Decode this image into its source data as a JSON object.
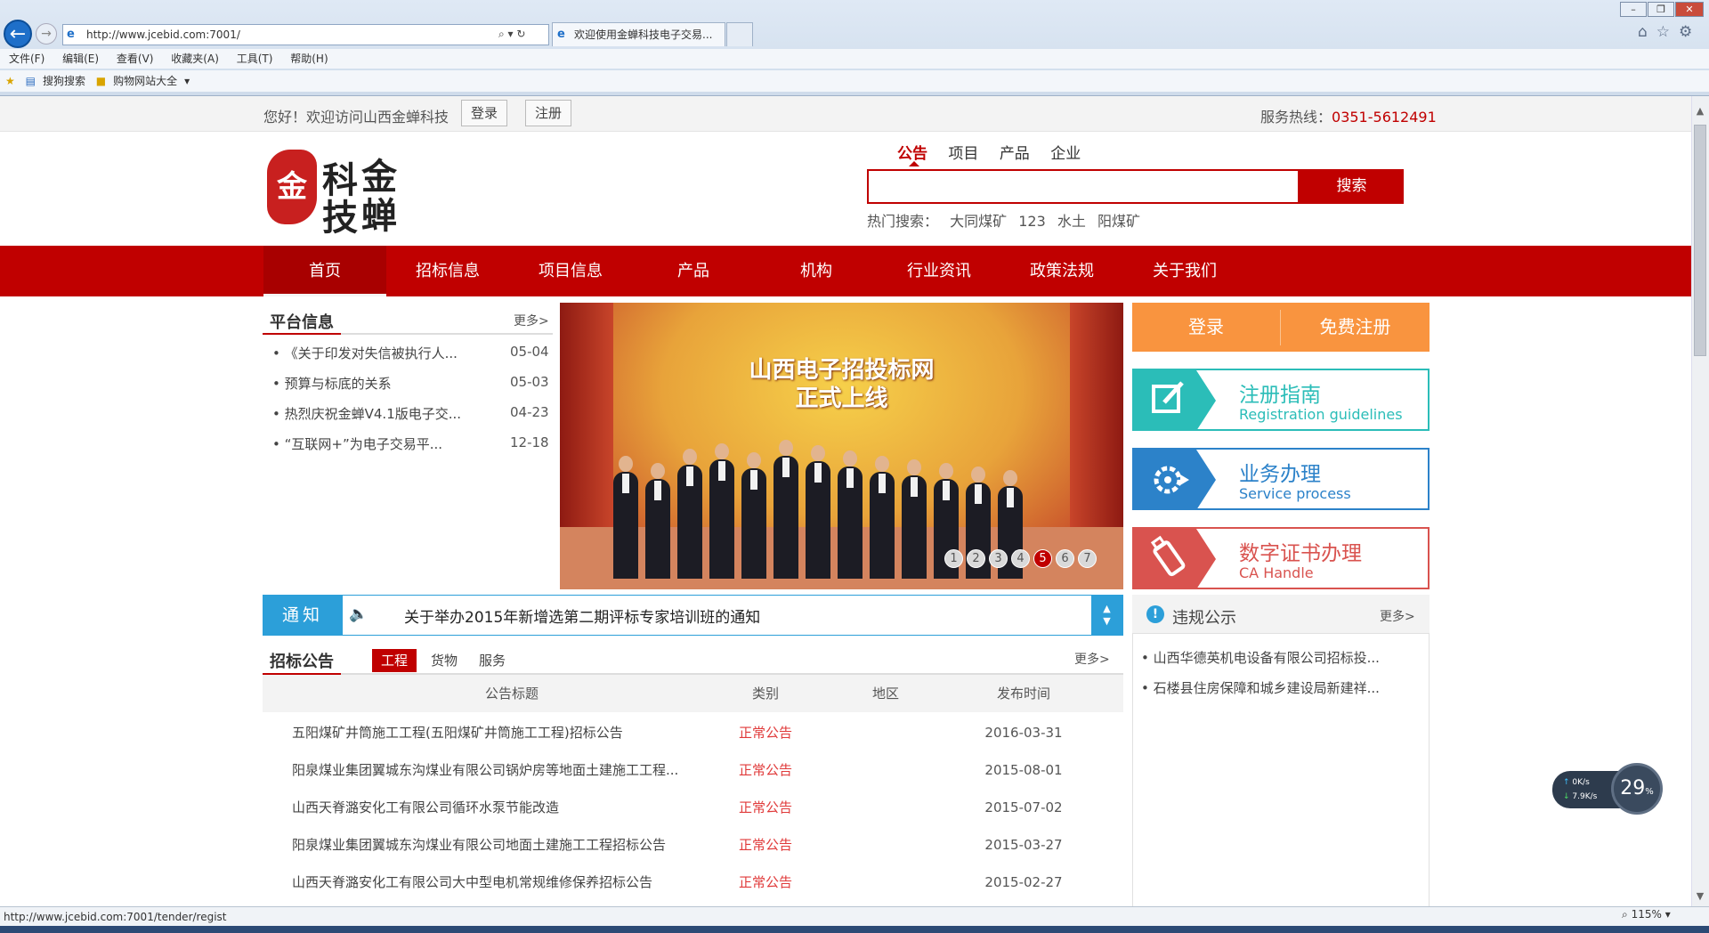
{
  "browser": {
    "url": "http://www.jcebid.com:7001/",
    "tab_title": "欢迎使用金蝉科技电子交易...",
    "menu": [
      "文件(F)",
      "编辑(E)",
      "查看(V)",
      "收藏夹(A)",
      "工具(T)",
      "帮助(H)"
    ],
    "favorites": [
      "搜狗搜索",
      "购物网站大全"
    ],
    "status_url": "http://www.jcebid.com:7001/tender/regist",
    "zoom": "115%"
  },
  "topbar": {
    "welcome": "您好！欢迎访问山西金蝉科技",
    "login": "登录",
    "register": "注册",
    "hotline_label": "服务热线：",
    "hotline_number": "0351-5612491"
  },
  "logo": {
    "seal": "金",
    "chars": [
      "科",
      "金",
      "技",
      "蝉"
    ]
  },
  "search": {
    "tabs": [
      "公告",
      "项目",
      "产品",
      "企业"
    ],
    "active_tab": "公告",
    "value": "",
    "button": "搜索",
    "hot_label": "热门搜索：",
    "hot_terms": [
      "大同煤矿",
      "123",
      "水土",
      "阳煤矿"
    ]
  },
  "nav": [
    "首页",
    "招标信息",
    "项目信息",
    "产品",
    "机构",
    "行业资讯",
    "政策法规",
    "关于我们"
  ],
  "platform": {
    "title": "平台信息",
    "more": "更多>",
    "items": [
      {
        "text": "• 《关于印发对失信被执行人...",
        "date": "05-04"
      },
      {
        "text": "• 预算与标底的关系",
        "date": "05-03"
      },
      {
        "text": "• 热烈庆祝金蝉V4.1版电子交...",
        "date": "04-23"
      },
      {
        "text": "• “互联网+”为电子交易平...",
        "date": "12-18"
      }
    ]
  },
  "banner": {
    "title1": "山西电子招投标网",
    "title2": "正式上线",
    "dots": [
      "1",
      "2",
      "3",
      "4",
      "5",
      "6",
      "7"
    ],
    "active": "5"
  },
  "side": {
    "login": "登录",
    "free_register": "免费注册",
    "cards": [
      {
        "title": "注册指南",
        "sub": "Registration guidelines",
        "color": "#2bbdb8",
        "icon": "edit-icon"
      },
      {
        "title": "业务办理",
        "sub": "Service process",
        "color": "#2c82c9",
        "icon": "gear-arrow-icon"
      },
      {
        "title": "数字证书办理",
        "sub": "CA Handle",
        "color": "#d9534f",
        "icon": "usb-key-icon"
      }
    ]
  },
  "notice": {
    "label": "通知",
    "text": "关于举办2015年新增选第二期评标专家培训班的通知"
  },
  "tender": {
    "title": "招标公告",
    "tabs": [
      "工程",
      "货物",
      "服务"
    ],
    "active_tab": "工程",
    "more": "更多>",
    "headers": [
      "公告标题",
      "类别",
      "地区",
      "发布时间"
    ],
    "rows": [
      {
        "title": "五阳煤矿井筒施工工程(五阳煤矿井筒施工工程)招标公告",
        "type": "正常公告",
        "region": "",
        "date": "2016-03-31"
      },
      {
        "title": "阳泉煤业集团翼城东沟煤业有限公司锅炉房等地面土建施工工程...",
        "type": "正常公告",
        "region": "",
        "date": "2015-08-01"
      },
      {
        "title": "山西天脊潞安化工有限公司循环水泵节能改造",
        "type": "正常公告",
        "region": "",
        "date": "2015-07-02"
      },
      {
        "title": "阳泉煤业集团翼城东沟煤业有限公司地面土建施工工程招标公告",
        "type": "正常公告",
        "region": "",
        "date": "2015-03-27"
      },
      {
        "title": "山西天脊潞安化工有限公司大中型电机常规维修保养招标公告",
        "type": "正常公告",
        "region": "",
        "date": "2015-02-27"
      }
    ]
  },
  "violation": {
    "title": "违规公示",
    "more": "更多>",
    "items": [
      "• 山西华德英机电设备有限公司招标投...",
      "• 石楼县住房保障和城乡建设局新建祥..."
    ]
  },
  "net_widget": {
    "up": "0K/s",
    "down": "7.9K/s",
    "cpu": "29",
    "cpu_unit": "%"
  }
}
